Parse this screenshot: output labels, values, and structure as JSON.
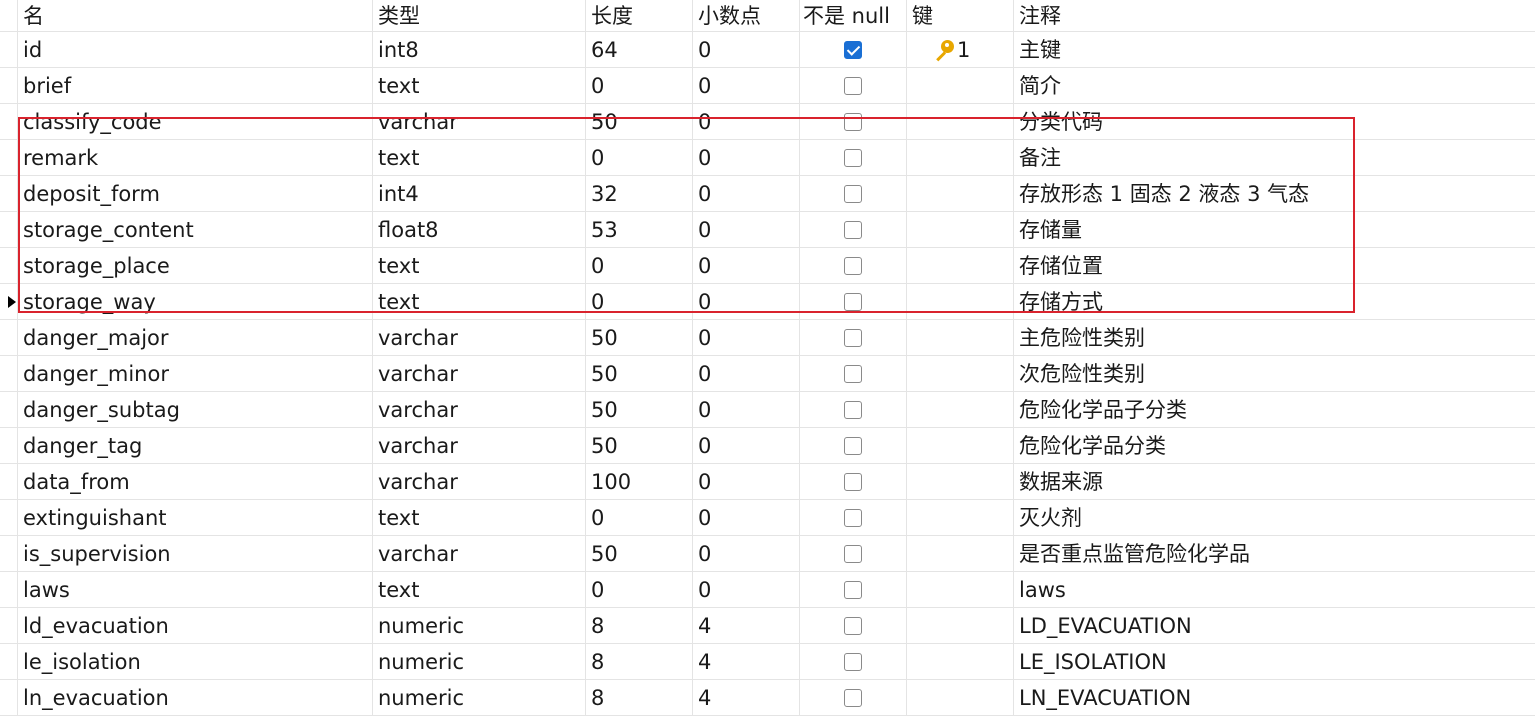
{
  "columns": [
    "名",
    "类型",
    "长度",
    "小数点",
    "不是 null",
    "键",
    "注释"
  ],
  "rows": [
    {
      "name": "id",
      "type": "int8",
      "length": "64",
      "decimals": "0",
      "not_null": true,
      "key": "1",
      "comment": "主键"
    },
    {
      "name": "brief",
      "type": "text",
      "length": "0",
      "decimals": "0",
      "not_null": false,
      "key": "",
      "comment": "简介"
    },
    {
      "name": "classify_code",
      "type": "varchar",
      "length": "50",
      "decimals": "0",
      "not_null": false,
      "key": "",
      "comment": "分类代码"
    },
    {
      "name": "remark",
      "type": "text",
      "length": "0",
      "decimals": "0",
      "not_null": false,
      "key": "",
      "comment": "备注"
    },
    {
      "name": "deposit_form",
      "type": "int4",
      "length": "32",
      "decimals": "0",
      "not_null": false,
      "key": "",
      "comment": "存放形态 1 固态 2 液态 3 气态"
    },
    {
      "name": "storage_content",
      "type": "float8",
      "length": "53",
      "decimals": "0",
      "not_null": false,
      "key": "",
      "comment": "存储量"
    },
    {
      "name": "storage_place",
      "type": "text",
      "length": "0",
      "decimals": "0",
      "not_null": false,
      "key": "",
      "comment": "存储位置"
    },
    {
      "name": "storage_way",
      "type": "text",
      "length": "0",
      "decimals": "0",
      "not_null": false,
      "key": "",
      "comment": "存储方式",
      "current": true
    },
    {
      "name": "danger_major",
      "type": "varchar",
      "length": "50",
      "decimals": "0",
      "not_null": false,
      "key": "",
      "comment": "主危险性类别"
    },
    {
      "name": "danger_minor",
      "type": "varchar",
      "length": "50",
      "decimals": "0",
      "not_null": false,
      "key": "",
      "comment": "次危险性类别"
    },
    {
      "name": "danger_subtag",
      "type": "varchar",
      "length": "50",
      "decimals": "0",
      "not_null": false,
      "key": "",
      "comment": "危险化学品子分类"
    },
    {
      "name": "danger_tag",
      "type": "varchar",
      "length": "50",
      "decimals": "0",
      "not_null": false,
      "key": "",
      "comment": "危险化学品分类"
    },
    {
      "name": "data_from",
      "type": "varchar",
      "length": "100",
      "decimals": "0",
      "not_null": false,
      "key": "",
      "comment": "数据来源"
    },
    {
      "name": "extinguishant",
      "type": "text",
      "length": "0",
      "decimals": "0",
      "not_null": false,
      "key": "",
      "comment": "灭火剂"
    },
    {
      "name": "is_supervision",
      "type": "varchar",
      "length": "50",
      "decimals": "0",
      "not_null": false,
      "key": "",
      "comment": "是否重点监管危险化学品"
    },
    {
      "name": "laws",
      "type": "text",
      "length": "0",
      "decimals": "0",
      "not_null": false,
      "key": "",
      "comment": "laws"
    },
    {
      "name": "ld_evacuation",
      "type": "numeric",
      "length": "8",
      "decimals": "4",
      "not_null": false,
      "key": "",
      "comment": "LD_EVACUATION"
    },
    {
      "name": "le_isolation",
      "type": "numeric",
      "length": "8",
      "decimals": "4",
      "not_null": false,
      "key": "",
      "comment": "LE_ISOLATION"
    },
    {
      "name": "ln_evacuation",
      "type": "numeric",
      "length": "8",
      "decimals": "4",
      "not_null": false,
      "key": "",
      "comment": "LN_EVACUATION"
    }
  ],
  "colors": {
    "checkbox_checked": "#1a6fd4",
    "key_icon": "#e8a700",
    "highlight_box": "#d9232d"
  },
  "icons": {
    "key": "key-icon",
    "row_pointer": "current-row-pointer-icon"
  }
}
